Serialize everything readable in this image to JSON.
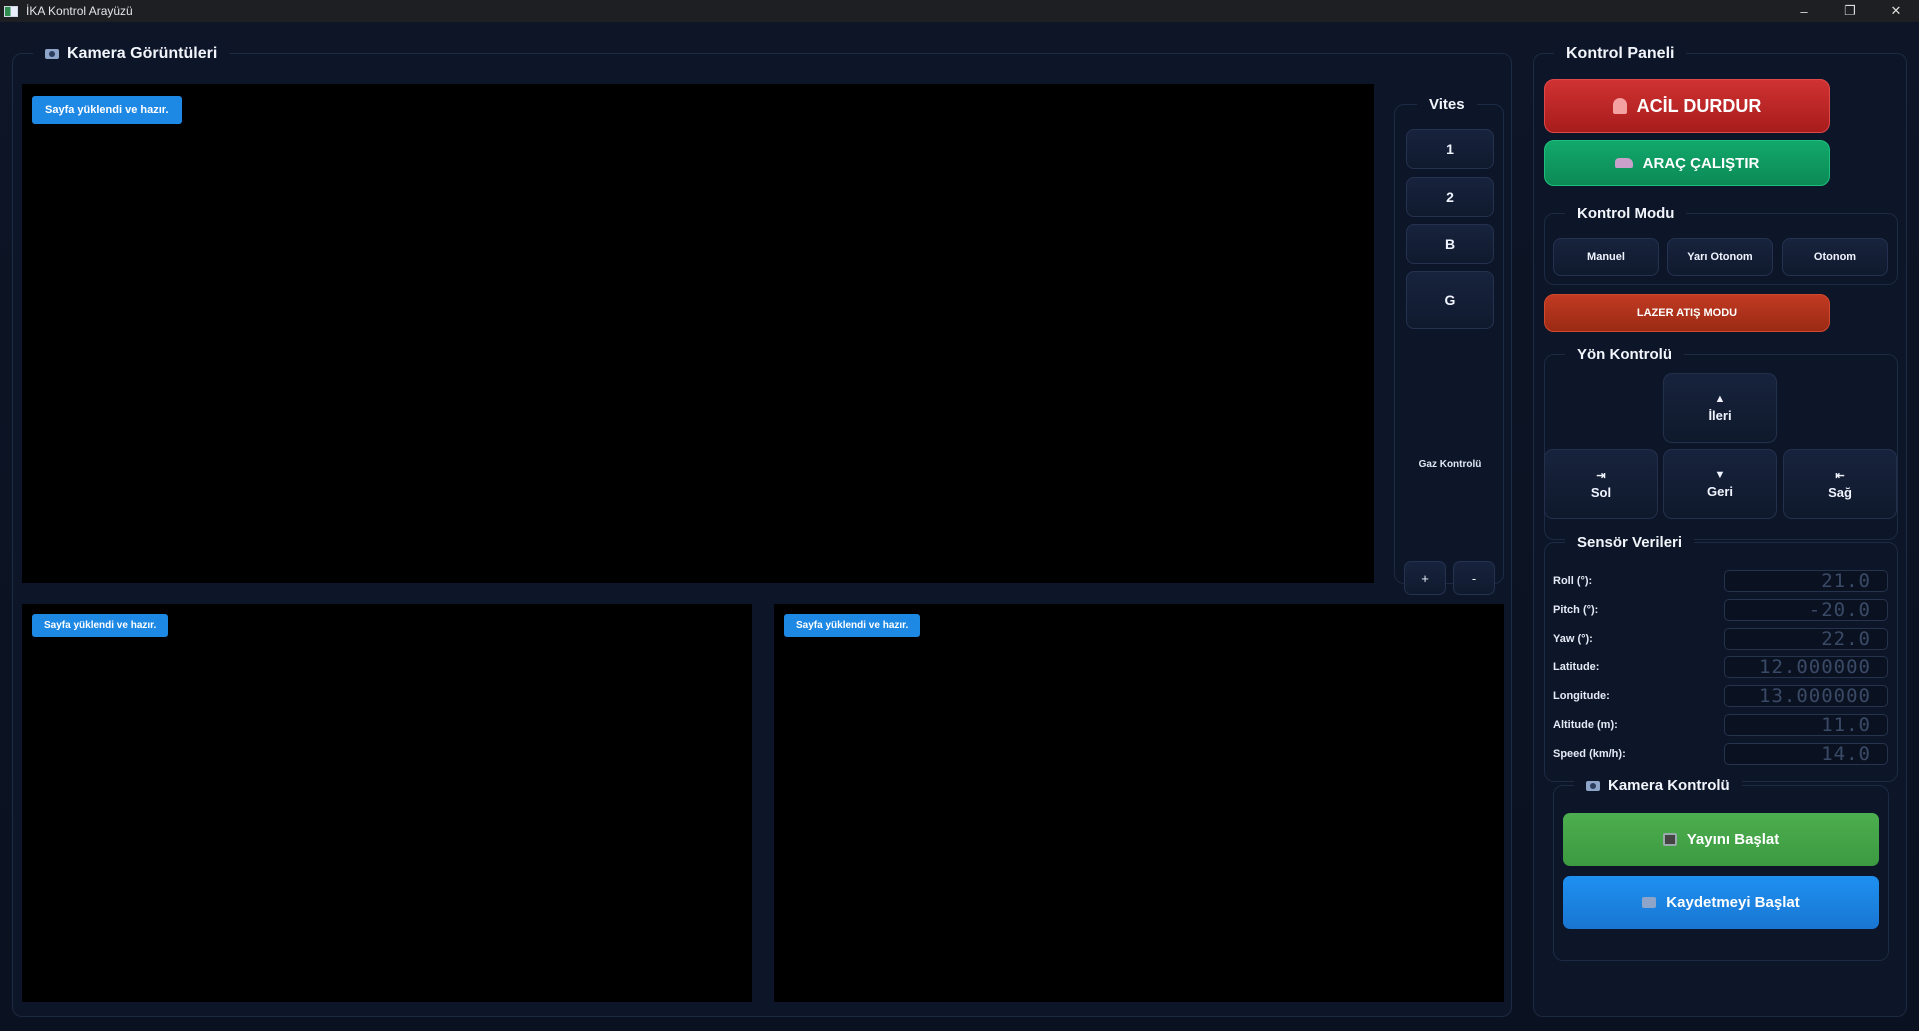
{
  "window": {
    "title": "İKA Kontrol Arayüzü",
    "controls": [
      "–",
      "❐",
      "✕"
    ]
  },
  "camera_panel": {
    "title": "Kamera Görüntüleri",
    "icon": "camera-icon",
    "views": [
      {
        "status": "Sayfa yüklendi ve hazır."
      },
      {
        "status": "Sayfa yüklendi ve hazır."
      },
      {
        "status": "Sayfa yüklendi ve hazır."
      }
    ]
  },
  "gear_panel": {
    "title": "Vites",
    "gears": [
      "1",
      "2",
      "B",
      "G"
    ],
    "gas_label": "Gaz Kontrolü",
    "plus": "+",
    "minus": "-"
  },
  "control_panel": {
    "title": "Kontrol Paneli",
    "emergency_stop": "ACİL DURDUR",
    "run_vehicle": "ARAÇ ÇALIŞTIR",
    "mode_title": "Kontrol Modu",
    "modes": [
      "Manuel",
      "Yarı Otonom",
      "Otonom"
    ],
    "laser_mode": "LAZER ATIŞ MODU",
    "direction_title": "Yön Kontrolü",
    "directions": {
      "forward": {
        "arrow": "▲",
        "label": "İleri"
      },
      "left": {
        "arrow": "⇥",
        "label": "Sol"
      },
      "back": {
        "arrow": "▼",
        "label": "Geri"
      },
      "right": {
        "arrow": "⇤",
        "label": "Sağ"
      }
    },
    "sensor_title": "Sensör Verileri",
    "sensors": [
      {
        "label": "Roll (°):",
        "value": "21.0"
      },
      {
        "label": "Pitch (°):",
        "value": "-20.0"
      },
      {
        "label": "Yaw (°):",
        "value": "22.0"
      },
      {
        "label": "Latitude:",
        "value": "12.000000"
      },
      {
        "label": "Longitude:",
        "value": "13.000000"
      },
      {
        "label": "Altitude (m):",
        "value": "11.0"
      },
      {
        "label": "Speed (km/h):",
        "value": "14.0"
      }
    ],
    "camera_control_title": "Kamera Kontrolü",
    "start_stream": "Yayını Başlat",
    "start_record": "Kaydetmeyi Başlat"
  },
  "colors": {
    "background": "#0b1220",
    "emergency": "#c62828",
    "run": "#10a36a",
    "laser": "#b23520",
    "stream": "#45a549",
    "record": "#1e88e5",
    "toast": "#1e88e5"
  }
}
